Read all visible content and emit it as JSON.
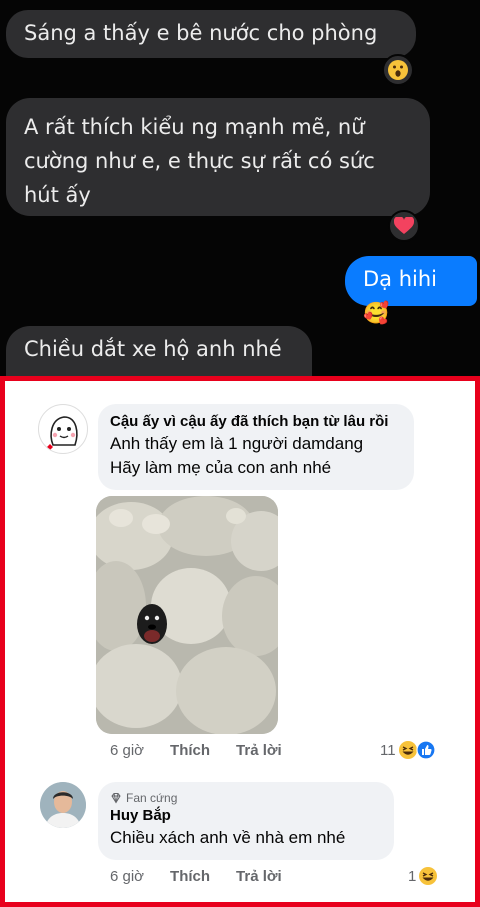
{
  "messages": [
    {
      "text": "Sáng a thấy e bê nước cho phòng",
      "reaction": "wow-emoji"
    },
    {
      "text_lines": [
        "A rất thích kiểu ng mạnh mẽ, nữ",
        "cường như e, e thực sự rất có sức",
        "hút ấy"
      ],
      "reaction": "heart-emoji"
    },
    {
      "text": "Dạ hihi 🥰",
      "sent": true
    },
    {
      "text": "Chiều dắt xe hộ anh nhé"
    }
  ],
  "comments": [
    {
      "name": "Cậu ấy vì cậu ấy đã thích bạn từ lâu rồi",
      "lines": [
        "Anh thấy em là 1 người damdang",
        "Hãy làm mẹ của con anh nhé"
      ],
      "time": "6 giờ",
      "like": "Thích",
      "reply": "Trả lời",
      "reaction_count": "11"
    },
    {
      "badge": "Fan cứng",
      "name": "Huy Bắp",
      "lines": [
        "Chiều xách anh về nhà em nhé"
      ],
      "time": "6 giờ",
      "like": "Thích",
      "reply": "Trả lời",
      "reaction_count": "1"
    }
  ],
  "colors": {
    "frame": "#e8001c",
    "messenger_blue": "#0a7cff",
    "dark_bubble": "#2e2e30"
  }
}
